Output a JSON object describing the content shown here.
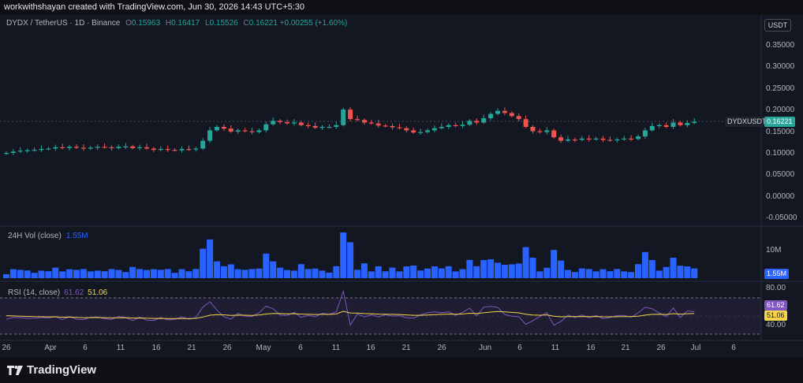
{
  "watermark": "workwithshayan created with TradingView.com, Jun 30, 2026 14:43 UTC+5:30",
  "legend": {
    "symbol": "DYDX / TetherUS · 1D · Binance",
    "open_label": "O",
    "open": "0.15963",
    "high_label": "H",
    "high": "0.16417",
    "low_label": "L",
    "low": "0.15526",
    "close_label": "C",
    "close": "0.16221",
    "change": "+0.00255 (+1.60%)"
  },
  "currency_button": "USDT",
  "price_axis": [
    "0.35000",
    "0.30000",
    "0.25000",
    "0.20000",
    "0.15000",
    "0.10000",
    "0.05000",
    "0.00000",
    "-0.05000"
  ],
  "price_tag": {
    "symbol": "DYDXUSDT",
    "value": "0.16221"
  },
  "volume": {
    "label": "24H Vol (close)",
    "value": "1.55M",
    "axis_label": "10M",
    "tag": "1.55M"
  },
  "rsi": {
    "label": "RSI (14, close)",
    "rsi_value": "61.62",
    "ma_value": "51.06",
    "upper": "80.00",
    "lower": "40.00",
    "tag_rsi": "61.62",
    "tag_ma": "51.06"
  },
  "time_axis": [
    "26",
    "Apr",
    "6",
    "11",
    "16",
    "21",
    "26",
    "May",
    "6",
    "11",
    "16",
    "21",
    "26",
    "Jun",
    "6",
    "11",
    "16",
    "21",
    "26",
    "Jul",
    "6"
  ],
  "brand": "TradingView",
  "colors": {
    "up": "#26a69a",
    "down": "#ef5350",
    "volume": "#2962ff",
    "rsi": "#7e57c2",
    "rsi_ma": "#f5d34a",
    "background": "#131722"
  },
  "chart_data": {
    "type": "candlestick",
    "symbol": "DYDXUSDT",
    "closes": [
      0.09,
      0.093,
      0.095,
      0.096,
      0.097,
      0.099,
      0.1,
      0.103,
      0.101,
      0.104,
      0.102,
      0.1,
      0.102,
      0.104,
      0.103,
      0.101,
      0.104,
      0.105,
      0.101,
      0.103,
      0.1,
      0.097,
      0.099,
      0.097,
      0.096,
      0.099,
      0.098,
      0.1,
      0.118,
      0.142,
      0.15,
      0.146,
      0.139,
      0.142,
      0.14,
      0.138,
      0.142,
      0.156,
      0.164,
      0.161,
      0.158,
      0.16,
      0.154,
      0.152,
      0.148,
      0.15,
      0.15,
      0.154,
      0.19,
      0.168,
      0.166,
      0.16,
      0.158,
      0.153,
      0.152,
      0.149,
      0.147,
      0.142,
      0.137,
      0.138,
      0.142,
      0.147,
      0.15,
      0.154,
      0.152,
      0.155,
      0.164,
      0.16,
      0.17,
      0.18,
      0.187,
      0.182,
      0.175,
      0.168,
      0.15,
      0.14,
      0.138,
      0.142,
      0.126,
      0.118,
      0.121,
      0.12,
      0.123,
      0.121,
      0.123,
      0.12,
      0.119,
      0.121,
      0.123,
      0.122,
      0.128,
      0.142,
      0.152,
      0.154,
      0.15,
      0.16,
      0.154,
      0.159,
      0.162
    ],
    "volume_ticks": [
      "10M"
    ],
    "rsi_levels": [
      80,
      40
    ],
    "rsi_last": 61.62,
    "rsi_ma_last": 51.06,
    "last_close": 0.16221,
    "ylim": [
      -0.05,
      0.35
    ]
  }
}
